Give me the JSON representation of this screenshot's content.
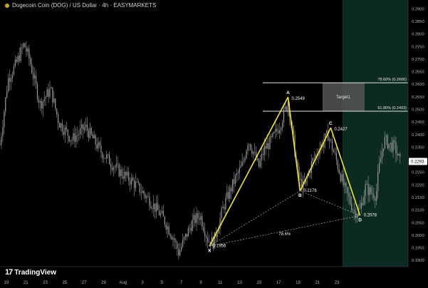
{
  "header": {
    "title": "Dogecoin Coin (DOG) / US Dollar · 4h · EASYMARKETS"
  },
  "brand": {
    "mark": "17",
    "name": "TradingView"
  },
  "chart_data": {
    "type": "candlestick",
    "symbol": "DOG/USD",
    "timeframe": "4h",
    "ylim": [
      0.1875,
      0.2935
    ],
    "y_ticks": [
      "0.2900",
      "0.2850",
      "0.2800",
      "0.2750",
      "0.2700",
      "0.2650",
      "0.2600",
      "0.2550",
      "0.2500",
      "0.2450",
      "0.2400",
      "0.2350",
      "0.2300",
      "0.2250",
      "0.2200",
      "0.2150",
      "0.2100",
      "0.2050",
      "0.2000",
      "0.1950",
      "0.1900"
    ],
    "x_ticks": [
      "19",
      "21",
      "23",
      "25",
      "27",
      "29",
      "Aug",
      "3",
      "5",
      "7",
      "9",
      "11",
      "13",
      "15",
      "17",
      "19",
      "21",
      "23"
    ],
    "last_price": "0.2293",
    "price_path": [
      {
        "t": 0,
        "p": 0.236
      },
      {
        "t": 3,
        "p": 0.262
      },
      {
        "t": 6,
        "p": 0.268
      },
      {
        "t": 9,
        "p": 0.276
      },
      {
        "t": 11,
        "p": 0.27
      },
      {
        "t": 15,
        "p": 0.252
      },
      {
        "t": 19,
        "p": 0.258
      },
      {
        "t": 22,
        "p": 0.245
      },
      {
        "t": 27,
        "p": 0.238
      },
      {
        "t": 32,
        "p": 0.243
      },
      {
        "t": 38,
        "p": 0.233
      },
      {
        "t": 44,
        "p": 0.226
      },
      {
        "t": 50,
        "p": 0.221
      },
      {
        "t": 56,
        "p": 0.214
      },
      {
        "t": 61,
        "p": 0.207
      },
      {
        "t": 65,
        "p": 0.199
      },
      {
        "t": 67,
        "p": 0.193
      },
      {
        "t": 69,
        "p": 0.198
      },
      {
        "t": 72,
        "p": 0.205
      },
      {
        "t": 75,
        "p": 0.208
      },
      {
        "t": 78,
        "p": 0.198
      },
      {
        "t": 80,
        "p": 0.197
      },
      {
        "t": 84,
        "p": 0.212
      },
      {
        "t": 88,
        "p": 0.222
      },
      {
        "t": 91,
        "p": 0.228
      },
      {
        "t": 93,
        "p": 0.238
      },
      {
        "t": 95,
        "p": 0.233
      },
      {
        "t": 97,
        "p": 0.227
      },
      {
        "t": 99,
        "p": 0.234
      },
      {
        "t": 102,
        "p": 0.238
      },
      {
        "t": 105,
        "p": 0.244
      },
      {
        "t": 108,
        "p": 0.253
      },
      {
        "t": 110,
        "p": 0.238
      },
      {
        "t": 112,
        "p": 0.222
      },
      {
        "t": 114,
        "p": 0.219
      },
      {
        "t": 117,
        "p": 0.229
      },
      {
        "t": 120,
        "p": 0.235
      },
      {
        "t": 123,
        "p": 0.24
      },
      {
        "t": 126,
        "p": 0.23
      },
      {
        "t": 129,
        "p": 0.219
      },
      {
        "t": 131,
        "p": 0.214
      },
      {
        "t": 133,
        "p": 0.209
      },
      {
        "t": 135,
        "p": 0.21
      },
      {
        "t": 137,
        "p": 0.219
      },
      {
        "t": 139,
        "p": 0.217
      },
      {
        "t": 141,
        "p": 0.216
      },
      {
        "t": 142,
        "p": 0.226
      },
      {
        "t": 144,
        "p": 0.238
      },
      {
        "t": 146,
        "p": 0.236
      },
      {
        "t": 148,
        "p": 0.235
      },
      {
        "t": 150,
        "p": 0.229
      }
    ],
    "harmonic_points": [
      {
        "label": "X",
        "value": "0.1956",
        "t": 78.5,
        "p": 0.1956
      },
      {
        "label": "A",
        "value": "0.2549",
        "t": 108,
        "p": 0.2549
      },
      {
        "label": "B",
        "value": "0.2176",
        "t": 112.5,
        "p": 0.2176
      },
      {
        "label": "C",
        "value": "0.2427",
        "t": 124,
        "p": 0.2427
      },
      {
        "label": "D",
        "value": "0.2078",
        "t": 135,
        "p": 0.2078
      }
    ],
    "ratio_label": "78.6%",
    "fib_lines": [
      {
        "label": "78.60% (0.2606)",
        "p": 0.2606
      },
      {
        "label": "61.80% (0.2493)",
        "p": 0.2493
      }
    ],
    "target": {
      "label": "Target1",
      "p_top": 0.2606,
      "p_bottom": 0.2493
    },
    "colors": {
      "background": "#000000",
      "candle": "#9a9a9a",
      "pattern": "#f5e52e",
      "projection_zone": "#0a2a22",
      "target_box": "#555555",
      "axis_text": "#b2b5be",
      "last_price_bg": "#ffffff"
    }
  }
}
